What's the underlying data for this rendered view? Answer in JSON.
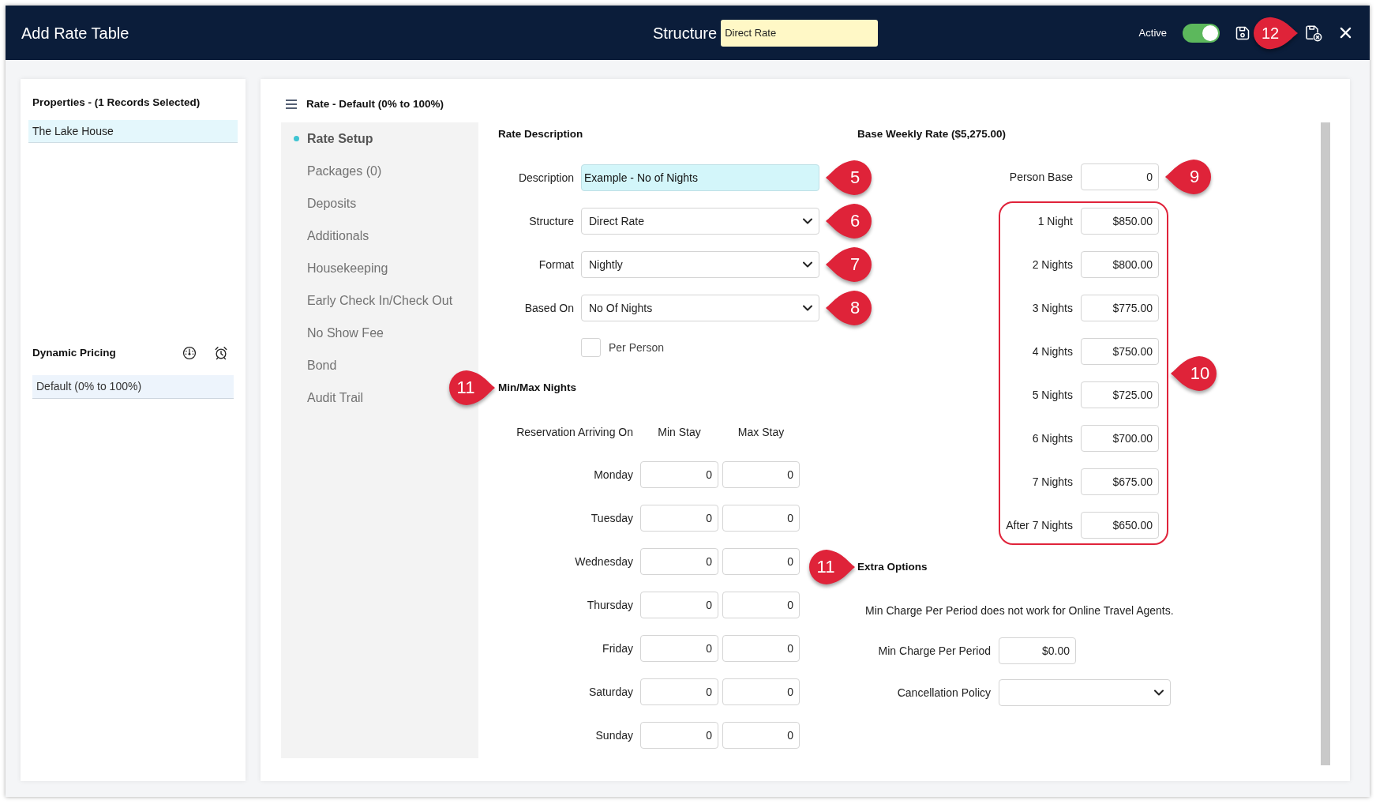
{
  "window": {
    "title": "Add Rate Table"
  },
  "header": {
    "structure": {
      "label": "Structure",
      "value": "Direct Rate"
    },
    "active_label": "Active",
    "active": true,
    "actions": [
      {
        "kind": "save"
      },
      {
        "kind": "save_close",
        "callout": "12"
      },
      {
        "kind": "close"
      }
    ]
  },
  "properties_panel": {
    "title": "Properties - (1 Records Selected)",
    "items": [
      {
        "label": "The Lake House",
        "selected": true
      }
    ]
  },
  "dynamic_pricing": {
    "title": "Dynamic Pricing",
    "items": [
      {
        "label": "Default (0% to 100%)",
        "selected": true
      }
    ]
  },
  "rate_panel": {
    "title": "Rate - Default (0% to 100%)"
  },
  "nav": [
    {
      "label": "Rate Setup",
      "selected": true
    },
    {
      "label": "Packages (0)",
      "selected": false
    },
    {
      "label": "Deposits",
      "selected": false
    },
    {
      "label": "Additionals",
      "selected": false
    },
    {
      "label": "Housekeeping",
      "selected": false
    },
    {
      "label": "Early Check In/Check Out",
      "selected": false
    },
    {
      "label": "No Show Fee",
      "selected": false
    },
    {
      "label": "Bond",
      "selected": false
    },
    {
      "label": "Audit Trail",
      "selected": false
    }
  ],
  "rate_description": {
    "heading": "Rate Description",
    "fields": [
      {
        "kind": "text",
        "label": "Description",
        "value": "Example - No of Nights",
        "focused": true,
        "callout": "5"
      },
      {
        "kind": "select",
        "label": "Structure",
        "value": "Direct Rate",
        "callout": "6"
      },
      {
        "kind": "select",
        "label": "Format",
        "value": "Nightly",
        "callout": "7"
      },
      {
        "kind": "select",
        "label": "Based On",
        "value": "No Of Nights",
        "callout": "8"
      }
    ],
    "per_person": {
      "label": "Per Person",
      "checked": false
    }
  },
  "min_max_nights": {
    "heading": "Min/Max Nights",
    "callout": "11",
    "columns": [
      "Reservation Arriving On",
      "Min Stay",
      "Max Stay"
    ],
    "rows": [
      {
        "day": "Monday",
        "min": "0",
        "max": "0"
      },
      {
        "day": "Tuesday",
        "min": "0",
        "max": "0"
      },
      {
        "day": "Wednesday",
        "min": "0",
        "max": "0"
      },
      {
        "day": "Thursday",
        "min": "0",
        "max": "0"
      },
      {
        "day": "Friday",
        "min": "0",
        "max": "0"
      },
      {
        "day": "Saturday",
        "min": "0",
        "max": "0"
      },
      {
        "day": "Sunday",
        "min": "0",
        "max": "0"
      }
    ]
  },
  "base_weekly_rate": {
    "heading": "Base Weekly Rate ($5,275.00)",
    "person_base": {
      "label": "Person Base",
      "value": "0",
      "callout": "9"
    },
    "nights": {
      "callout": "10",
      "rows": [
        {
          "label": "1 Night",
          "value": "$850.00"
        },
        {
          "label": "2 Nights",
          "value": "$800.00"
        },
        {
          "label": "3 Nights",
          "value": "$775.00"
        },
        {
          "label": "4 Nights",
          "value": "$750.00"
        },
        {
          "label": "5 Nights",
          "value": "$725.00"
        },
        {
          "label": "6 Nights",
          "value": "$700.00"
        },
        {
          "label": "7 Nights",
          "value": "$675.00"
        },
        {
          "label": "After 7 Nights",
          "value": "$650.00"
        }
      ]
    }
  },
  "extra_options": {
    "heading": "Extra Options",
    "callout": "11",
    "note": "Min Charge Per Period does not work for Online Travel Agents.",
    "min_charge": {
      "label": "Min Charge Per Period",
      "value": "$0.00"
    },
    "cancellation_policy": {
      "label": "Cancellation Policy"
    }
  }
}
